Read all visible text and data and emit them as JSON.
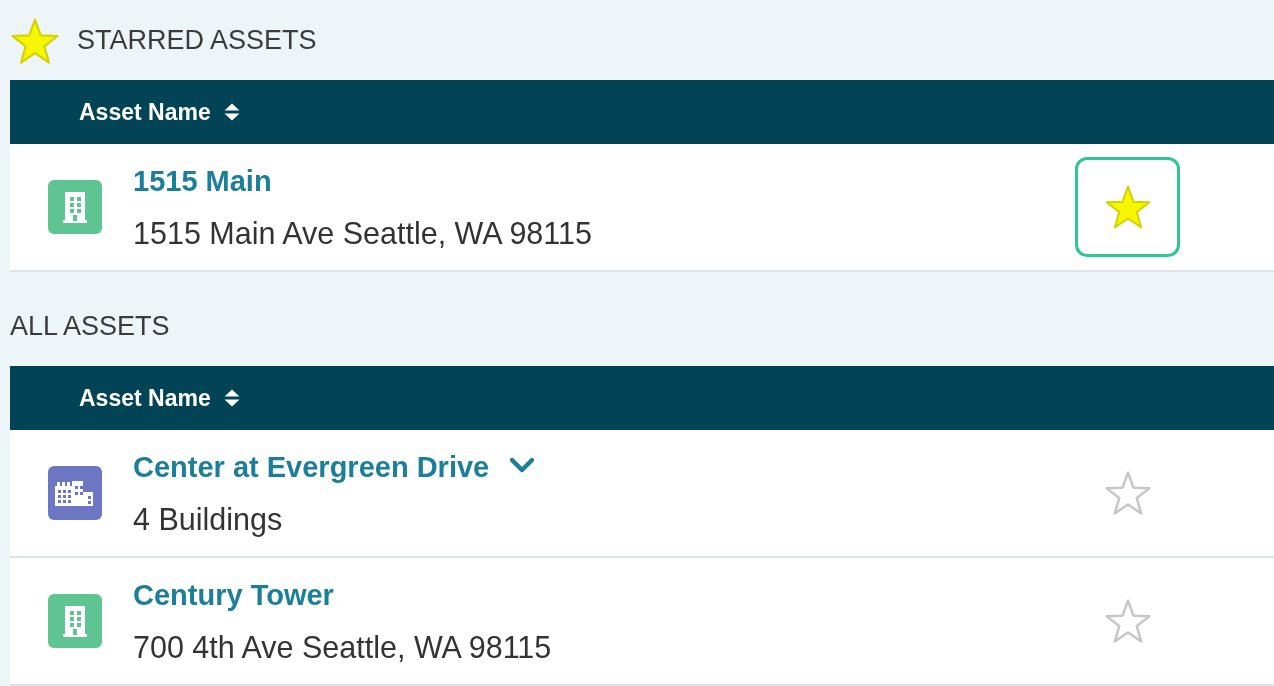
{
  "sections": [
    {
      "kind": "starred",
      "title": "STARRED ASSETS",
      "columns": [
        {
          "label": "Asset Name"
        }
      ],
      "rows": [
        {
          "kind": "building",
          "name": "1515 Main",
          "detail": "1515 Main Ave Seattle, WA 98115",
          "starred": true,
          "focused": true
        }
      ]
    },
    {
      "kind": "all",
      "title": "ALL ASSETS",
      "columns": [
        {
          "label": "Asset Name"
        }
      ],
      "rows": [
        {
          "kind": "campus",
          "name": "Center at Evergreen Drive",
          "expanded": false,
          "detail": "4 Buildings",
          "starred": false,
          "focused": false
        },
        {
          "kind": "building",
          "name": "Century Tower",
          "detail": "700 4th Ave Seattle, WA 98115",
          "starred": false,
          "focused": false
        }
      ]
    }
  ]
}
